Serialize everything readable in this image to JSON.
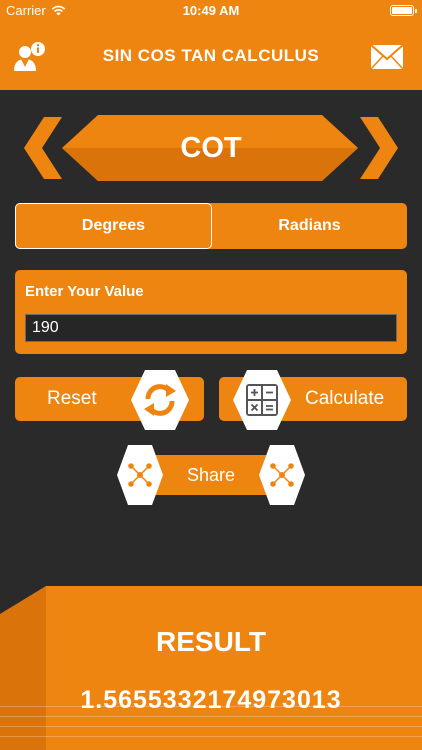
{
  "status_bar": {
    "carrier": "Carrier",
    "time": "10:49 AM"
  },
  "header": {
    "title": "SIN COS TAN CALCULUS",
    "profile_icon": "user-info-icon",
    "mail_icon": "mail-icon"
  },
  "function_selector": {
    "current": "COT"
  },
  "unit_toggle": {
    "options": [
      "Degrees",
      "Radians"
    ],
    "selected": "Degrees"
  },
  "input": {
    "label": "Enter Your Value",
    "value": "190"
  },
  "actions": {
    "reset_label": "Reset",
    "calculate_label": "Calculate",
    "share_label": "Share"
  },
  "result": {
    "title": "RESULT",
    "value": "1.5655332174973013"
  },
  "colors": {
    "accent": "#ee8511",
    "background": "#2a2a2a",
    "accent_dark": "#d9730a"
  }
}
